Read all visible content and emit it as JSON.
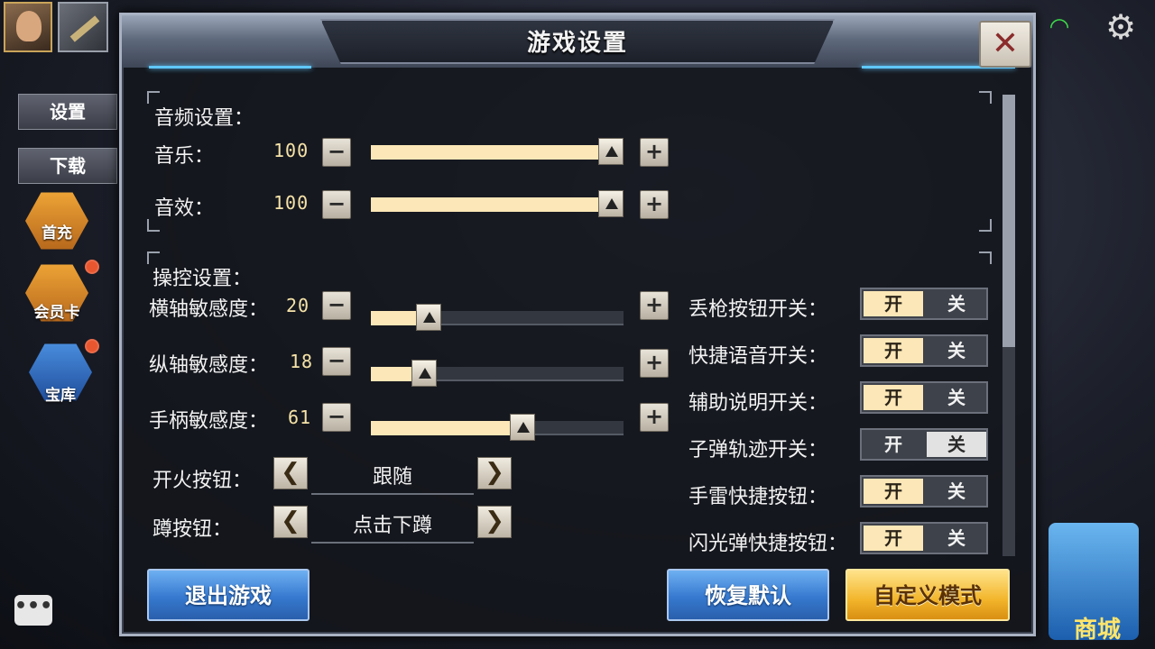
{
  "hud": {
    "side_tabs": [
      "设置",
      "下载"
    ],
    "hex_buttons": [
      "首充",
      "会员卡",
      "宝库"
    ],
    "chat_icon": "chat-bubble-icon",
    "gear_icon": "gear-icon",
    "wifi_icon": "wifi-icon",
    "shop_label": "商城"
  },
  "dialog": {
    "title": "游戏设置",
    "close_label": "✕",
    "audio": {
      "section_title": "音频设置：",
      "rows": [
        {
          "label": "音乐：",
          "value": "100",
          "level": 100
        },
        {
          "label": "音效：",
          "value": "100",
          "level": 100
        }
      ]
    },
    "controls": {
      "section_title": "操控设置：",
      "sliders": [
        {
          "label": "横轴敏感度：",
          "value": "20",
          "level": 20
        },
        {
          "label": "纵轴敏感度：",
          "value": "18",
          "level": 18
        },
        {
          "label": "手柄敏感度：",
          "value": "61",
          "level": 61
        }
      ],
      "choices": [
        {
          "label": "开火按钮：",
          "value": "跟随"
        },
        {
          "label": "蹲按钮：",
          "value": "点击下蹲"
        }
      ],
      "toggles": [
        {
          "label": "丢枪按钮开关：",
          "state": "on"
        },
        {
          "label": "快捷语音开关：",
          "state": "on"
        },
        {
          "label": "辅助说明开关：",
          "state": "on"
        },
        {
          "label": "子弹轨迹开关：",
          "state": "off"
        },
        {
          "label": "手雷快捷按钮：",
          "state": "on"
        },
        {
          "label": "闪光弹快捷按钮：",
          "state": "on"
        }
      ],
      "toggle_on_text": "开",
      "toggle_off_text": "关"
    },
    "minus": "−",
    "plus": "+",
    "arrow_left": "❮",
    "arrow_right": "❯",
    "footer": {
      "exit": "退出游戏",
      "reset": "恢复默认",
      "custom": "自定义模式"
    },
    "colors": {
      "slider_fill": "#fbe7b7",
      "toggle_on": "#fbe7b7",
      "blue_button": "#3679cf",
      "gold_button": "#f2b52b"
    }
  }
}
